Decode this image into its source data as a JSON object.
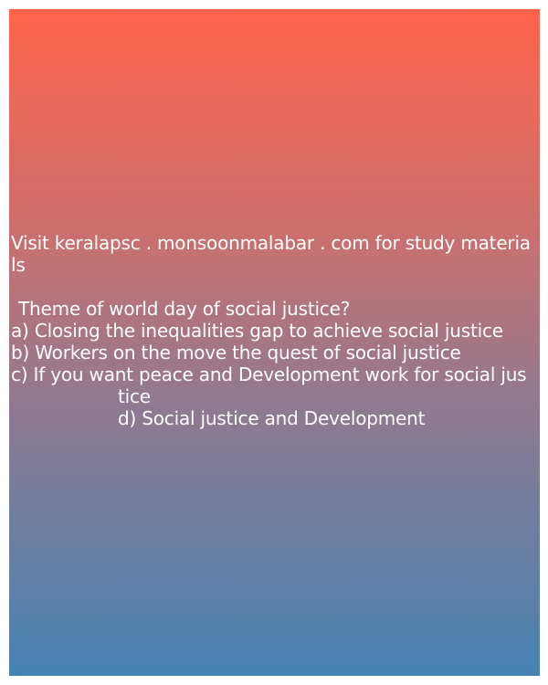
{
  "header_line_1": "Visit keralapsc . monsoonmalabar . com for study materia",
  "header_line_2": "ls",
  "question": "Theme of world day of social justice?",
  "options": {
    "a": "a) Closing the inequalities gap to achieve social justice",
    "b": "b) Workers on the move the quest of social justice",
    "c_part1": "c) If you want peace and Development work for social jus",
    "c_part2": "tice",
    "d": "d) Social justice and Development"
  },
  "colors": {
    "gradient_top": "#ff634a",
    "gradient_bottom": "#4682b4",
    "text": "#ffffff"
  }
}
